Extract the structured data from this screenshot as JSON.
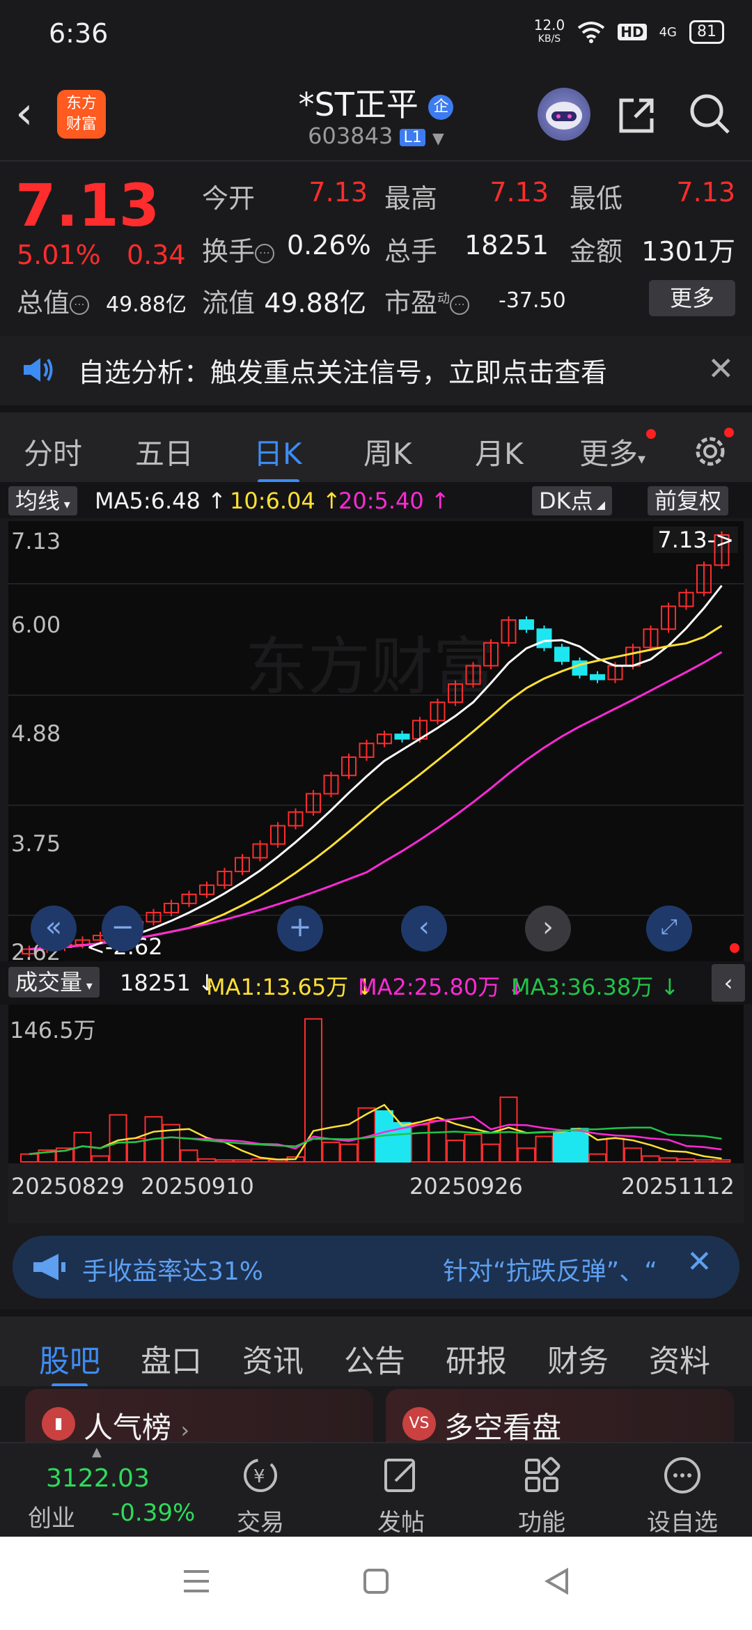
{
  "status_bar": {
    "time": "6:36",
    "net_speed": "12.0",
    "net_unit": "KB/S",
    "hd": "HD",
    "signal": "4G",
    "battery": "81"
  },
  "header": {
    "logo_line1": "东方",
    "logo_line2": "财富",
    "name": "*ST正平",
    "corp_badge": "企",
    "code": "603843",
    "level": "L1"
  },
  "quote": {
    "price": "7.13",
    "pct": "5.01%",
    "change": "0.34",
    "open_label": "今开",
    "open": "7.13",
    "high_label": "最高",
    "high": "7.13",
    "low_label": "最低",
    "low": "7.13",
    "turnover_label": "换手",
    "turnover": "0.26%",
    "volume_label": "总手",
    "volume": "18251",
    "amount_label": "金额",
    "amount": "1301万",
    "mktcap_label": "总值",
    "mktcap": "49.88亿",
    "float_label": "流值",
    "float": "49.88亿",
    "pe_label": "市盈",
    "pe_sup": "动",
    "pe": "-37.50",
    "more": "更多"
  },
  "analysis": {
    "text": "自选分析：触发重点关注信号，立即点击查看"
  },
  "tabs": [
    "分时",
    "五日",
    "日K",
    "周K",
    "月K",
    "更多"
  ],
  "active_tab": "日K",
  "ma_bar": {
    "chip": "均线",
    "ma5": "MA5:6.48",
    "ma10": "10:6.04",
    "ma20": "20:5.40",
    "dk": "DK点",
    "adjust": "前复权"
  },
  "kchart": {
    "y_labels": [
      "7.13",
      "6.00",
      "4.88",
      "3.75",
      "2.62"
    ],
    "max_tag": "7.13->",
    "min_tag": "<-2.62",
    "watermark": "东方财富"
  },
  "vol_bar": {
    "chip": "成交量",
    "vol": "18251",
    "ma1": "MA1:13.65万",
    "ma2": "MA2:25.80万",
    "ma3": "MA3:36.38万",
    "y_max": "146.5万"
  },
  "dates": [
    "20250829",
    "20250910",
    "20250926",
    "20251112"
  ],
  "ad": {
    "left": "手收益率达31%",
    "right": "针对“抗跌反弹”、“"
  },
  "sections": [
    "股吧",
    "盘口",
    "资讯",
    "公告",
    "研报",
    "财务",
    "资料"
  ],
  "cards": {
    "left": "人气榜",
    "right": "多空看盘",
    "right_icon": "VS"
  },
  "bottom_nav": {
    "index_value": "3122.03",
    "index_name": "创业",
    "index_change": "-0.39%",
    "items": [
      "交易",
      "发帖",
      "功能",
      "设自选"
    ]
  },
  "colors": {
    "up": "#ff2d2d",
    "down": "#2ddc5a",
    "accent": "#3d8cf5",
    "ma5": "#ffffff",
    "ma10": "#ffe135",
    "ma20": "#ff2ad6",
    "cyan": "#1ee6f0"
  }
}
